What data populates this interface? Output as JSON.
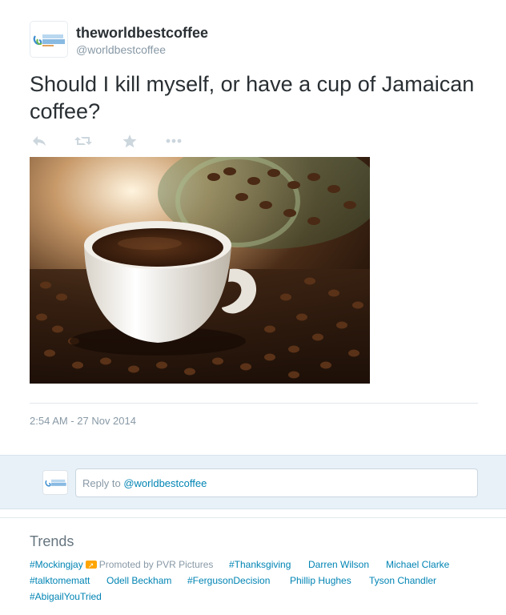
{
  "tweet": {
    "fullname": "theworldbestcoffee",
    "screenname": "@worldbestcoffee",
    "text": "Should I kill myself, or have a cup of Jamaican coffee?",
    "timestamp": "2:54 AM - 27 Nov 2014",
    "actions": {
      "reply_icon": "reply-icon",
      "retweet_icon": "retweet-icon",
      "favorite_icon": "star-icon",
      "more_icon": "ellipsis-icon"
    },
    "media": {
      "subject": "cup of coffee with coffee beans"
    }
  },
  "reply": {
    "prefix": "Reply to ",
    "mention": "@worldbestcoffee"
  },
  "trends": {
    "title": "Trends",
    "items": [
      "#Mockingjay",
      "Promoted by PVR Pictures",
      "#Thanksgiving",
      "Darren Wilson",
      "Michael Clarke",
      "#talktomematt",
      "Odell Beckham",
      "#FergusonDecision",
      "Phillip Hughes",
      "Tyson Chandler",
      "#AbigailYouTried"
    ]
  },
  "colors": {
    "link": "#0084b4",
    "muted": "#8899a6",
    "reply_bg": "#e8f1f8",
    "promo": "#ffa500"
  }
}
